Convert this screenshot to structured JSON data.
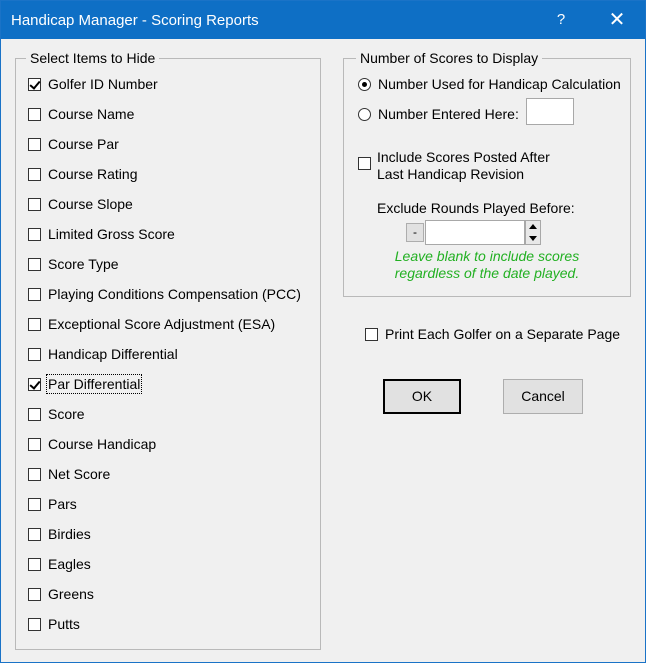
{
  "window": {
    "title": "Handicap Manager - Scoring Reports",
    "help_glyph": "?",
    "close_glyph": "✕"
  },
  "hide_group": {
    "legend": "Select Items to Hide",
    "items": [
      {
        "label": "Golfer ID Number",
        "checked": true
      },
      {
        "label": "Course Name",
        "checked": false
      },
      {
        "label": "Course Par",
        "checked": false
      },
      {
        "label": "Course Rating",
        "checked": false
      },
      {
        "label": "Course Slope",
        "checked": false
      },
      {
        "label": "Limited Gross Score",
        "checked": false
      },
      {
        "label": "Score Type",
        "checked": false
      },
      {
        "label": "Playing Conditions Compensation (PCC)",
        "checked": false
      },
      {
        "label": "Exceptional Score Adjustment (ESA)",
        "checked": false
      },
      {
        "label": "Handicap Differential",
        "checked": false
      },
      {
        "label": "Par Differential",
        "checked": true
      },
      {
        "label": "Score",
        "checked": false
      },
      {
        "label": "Course Handicap",
        "checked": false
      },
      {
        "label": "Net Score",
        "checked": false
      },
      {
        "label": "Pars",
        "checked": false
      },
      {
        "label": "Birdies",
        "checked": false
      },
      {
        "label": "Eagles",
        "checked": false
      },
      {
        "label": "Greens",
        "checked": false
      },
      {
        "label": "Putts",
        "checked": false
      }
    ]
  },
  "scores_group": {
    "legend": "Number of Scores to Display",
    "radio_handicap_label": "Number Used for Handicap Calculation",
    "radio_entered_label": "Number Entered Here:",
    "number_value": "",
    "include_posted_line1": "Include Scores Posted After",
    "include_posted_line2": "Last Handicap Revision",
    "exclude_label": "Exclude Rounds Played Before:",
    "minus_label": "-",
    "date_value": "",
    "hint_line1": "Leave blank to include scores",
    "hint_line2": "regardless of the date played."
  },
  "print_separate_label": "Print Each Golfer on a Separate Page",
  "buttons": {
    "ok": "OK",
    "cancel": "Cancel"
  },
  "colors": {
    "titlebar": "#0e6fc5",
    "dialog_bg": "#f0f0f0",
    "hint_text": "#22b022"
  }
}
